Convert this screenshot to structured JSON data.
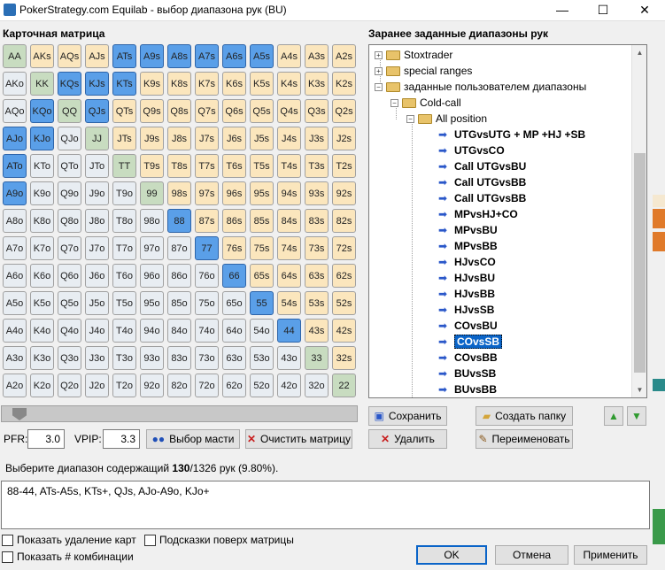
{
  "window": {
    "title": "PokerStrategy.com Equilab - выбор диапазона рук (BU)"
  },
  "matrix_label": "Карточная матрица",
  "presets_label": "Заранее заданные диапазоны рук",
  "matrix": [
    [
      "AA",
      "AKs",
      "AQs",
      "AJs",
      "ATs",
      "A9s",
      "A8s",
      "A7s",
      "A6s",
      "A5s",
      "A4s",
      "A3s",
      "A2s"
    ],
    [
      "AKo",
      "KK",
      "KQs",
      "KJs",
      "KTs",
      "K9s",
      "K8s",
      "K7s",
      "K6s",
      "K5s",
      "K4s",
      "K3s",
      "K2s"
    ],
    [
      "AQo",
      "KQo",
      "QQ",
      "QJs",
      "QTs",
      "Q9s",
      "Q8s",
      "Q7s",
      "Q6s",
      "Q5s",
      "Q4s",
      "Q3s",
      "Q2s"
    ],
    [
      "AJo",
      "KJo",
      "QJo",
      "JJ",
      "JTs",
      "J9s",
      "J8s",
      "J7s",
      "J6s",
      "J5s",
      "J4s",
      "J3s",
      "J2s"
    ],
    [
      "ATo",
      "KTo",
      "QTo",
      "JTo",
      "TT",
      "T9s",
      "T8s",
      "T7s",
      "T6s",
      "T5s",
      "T4s",
      "T3s",
      "T2s"
    ],
    [
      "A9o",
      "K9o",
      "Q9o",
      "J9o",
      "T9o",
      "99",
      "98s",
      "97s",
      "96s",
      "95s",
      "94s",
      "93s",
      "92s"
    ],
    [
      "A8o",
      "K8o",
      "Q8o",
      "J8o",
      "T8o",
      "98o",
      "88",
      "87s",
      "86s",
      "85s",
      "84s",
      "83s",
      "82s"
    ],
    [
      "A7o",
      "K7o",
      "Q7o",
      "J7o",
      "T7o",
      "97o",
      "87o",
      "77",
      "76s",
      "75s",
      "74s",
      "73s",
      "72s"
    ],
    [
      "A6o",
      "K6o",
      "Q6o",
      "J6o",
      "T6o",
      "96o",
      "86o",
      "76o",
      "66",
      "65s",
      "64s",
      "63s",
      "62s"
    ],
    [
      "A5o",
      "K5o",
      "Q5o",
      "J5o",
      "T5o",
      "95o",
      "85o",
      "75o",
      "65o",
      "55",
      "54s",
      "53s",
      "52s"
    ],
    [
      "A4o",
      "K4o",
      "Q4o",
      "J4o",
      "T4o",
      "94o",
      "84o",
      "74o",
      "64o",
      "54o",
      "44",
      "43s",
      "42s"
    ],
    [
      "A3o",
      "K3o",
      "Q3o",
      "J3o",
      "T3o",
      "93o",
      "83o",
      "73o",
      "63o",
      "53o",
      "43o",
      "33",
      "32s"
    ],
    [
      "A2o",
      "K2o",
      "Q2o",
      "J2o",
      "T2o",
      "92o",
      "82o",
      "72o",
      "62o",
      "52o",
      "42o",
      "32o",
      "22"
    ]
  ],
  "selected_hands": [
    "ATs",
    "A9s",
    "A8s",
    "A7s",
    "A6s",
    "A5s",
    "KQs",
    "KJs",
    "KTs",
    "KQo",
    "QJs",
    "AJo",
    "KJo",
    "ATo",
    "A9o",
    "88",
    "77",
    "66",
    "55",
    "44"
  ],
  "tree": {
    "folders": [
      "Stoxtrader",
      "special ranges",
      "заданные пользователем диапазоны"
    ],
    "subfolder": "Cold-call",
    "subsubfolder": "All position",
    "items": [
      "UTGvsUTG + MP +HJ +SB",
      "UTGvsCO",
      "Call UTGvsBU",
      "Call UTGvsBB",
      "Call UTGvsBB",
      "MPvsHJ+CO",
      "MPvsBU",
      "MPvsBB",
      "HJvsCO",
      "HJvsBU",
      "HJvsBB",
      "HJvsSB",
      "COvsBU",
      "COvsSB",
      "COvsBB",
      "BUvsSB",
      "BUvsBB"
    ],
    "selected_index": 13
  },
  "buttons": {
    "save": "Сохранить",
    "create_folder": "Создать папку",
    "delete": "Удалить",
    "rename": "Переименовать",
    "suit_select": "Выбор масти",
    "clear_matrix": "Очистить матрицу",
    "ok": "OK",
    "cancel": "Отмена",
    "apply": "Применить"
  },
  "stats": {
    "pfr_label": "PFR:",
    "pfr_value": "3.0",
    "vpip_label": "VPIP:",
    "vpip_value": "3.3"
  },
  "info": {
    "prefix": "Выберите диапазон содержащий ",
    "count": "130",
    "suffix": "/1326 рук (9.80%)."
  },
  "range_text": "88-44, ATs-A5s, KTs+, QJs, AJo-A9o, KJo+",
  "checkboxes": {
    "show_card_removal": "Показать удаление карт",
    "hints_over_matrix": "Подсказки поверх матрицы",
    "show_combos": "Показать # комбинации"
  },
  "colors": {
    "pair": "#c8dcc0",
    "suited": "#fbe6bd",
    "offsuit": "#e8edf2",
    "selected": "#5a9fe8",
    "tree_selected": "#0a64c8"
  }
}
